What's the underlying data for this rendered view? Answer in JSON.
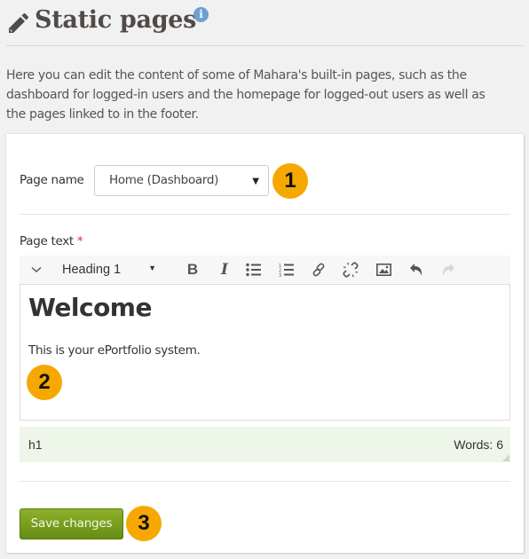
{
  "header": {
    "title": "Static pages",
    "icon": "pencil-icon",
    "info_icon": "info-icon",
    "info_glyph": "i"
  },
  "intro_text": "Here you can edit the content of some of Mahara's built-in pages, such as the dashboard for logged-in users and the homepage for logged-out users as well as the pages linked to in the footer.",
  "form": {
    "page_name_label": "Page name",
    "page_name_selected": "Home (Dashboard)",
    "page_text_label": "Page text",
    "required_marker": "*",
    "toolbar": {
      "format_selected": "Heading 1",
      "bold_glyph": "B",
      "italic_glyph": "I",
      "buttons": [
        "toggle-toolbar",
        "format-select",
        "bold",
        "italic",
        "bullet-list",
        "numbered-list",
        "insert-link",
        "remove-link",
        "insert-image",
        "undo",
        "redo"
      ]
    },
    "editor": {
      "heading": "Welcome",
      "paragraph": "This is your ePortfolio system."
    },
    "statusbar": {
      "path": "h1",
      "word_count": "Words: 6"
    },
    "save_label": "Save changes"
  },
  "callouts": [
    "1",
    "2",
    "3"
  ],
  "colors": {
    "callout": "#f6a800",
    "save_button": "#7a9e1f",
    "statusbar_bg": "#eef5e9",
    "info_icon": "#6f9ed3",
    "required": "#d9302e"
  }
}
